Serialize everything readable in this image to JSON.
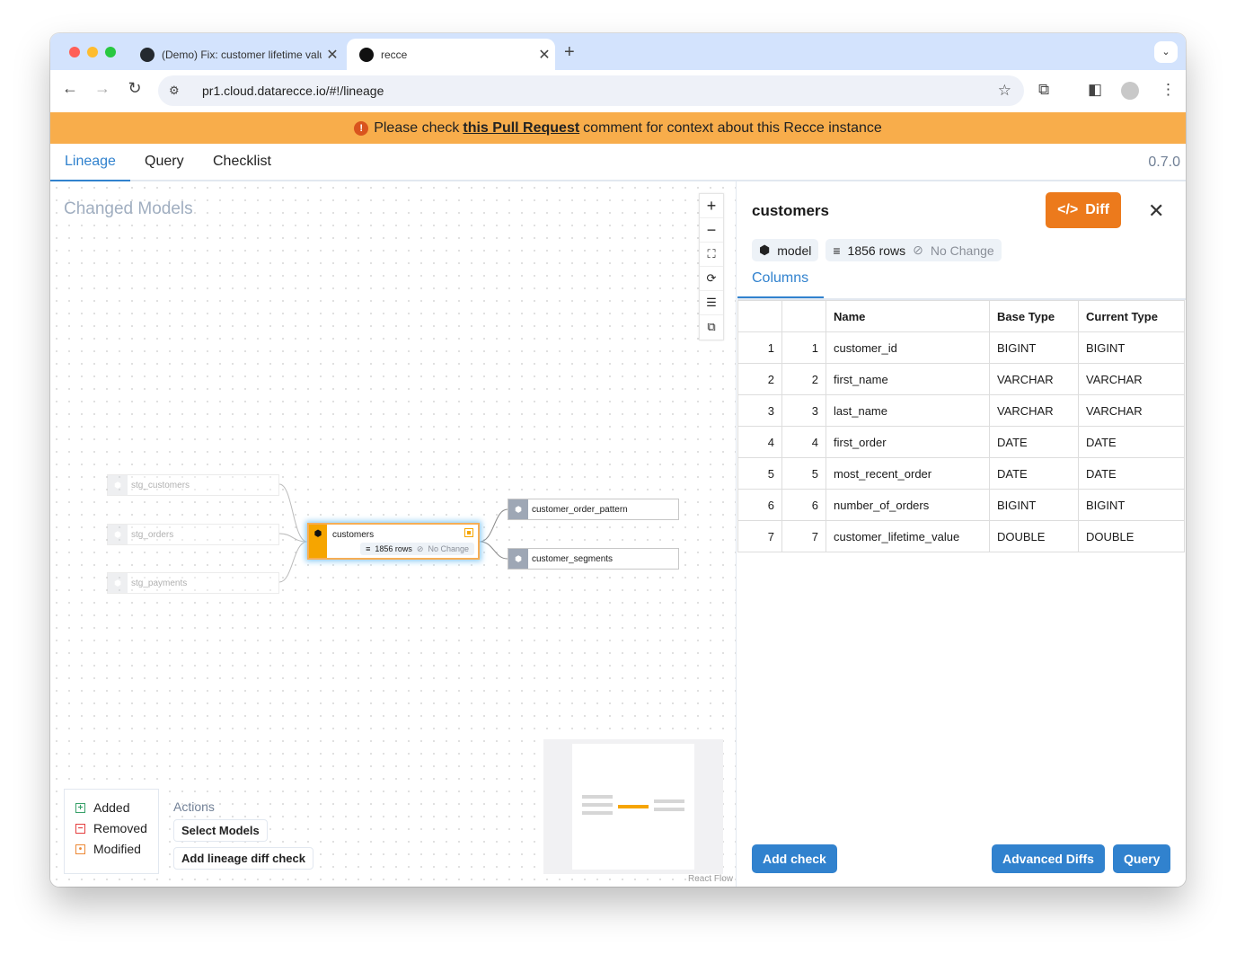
{
  "browser": {
    "tabs": [
      {
        "title": "(Demo) Fix: customer lifetime value"
      },
      {
        "title": "recce"
      }
    ],
    "url": "pr1.cloud.datarecce.io/#!/lineage"
  },
  "banner": {
    "pre": "Please check",
    "link": "this Pull Request",
    "post": "comment for context about this Recce instance"
  },
  "nav": {
    "tabs": [
      "Lineage",
      "Query",
      "Checklist"
    ],
    "active": "Lineage",
    "version": "0.7.0"
  },
  "canvas": {
    "title": "Changed Models",
    "upstream": [
      "stg_customers",
      "stg_orders",
      "stg_payments"
    ],
    "main": {
      "name": "customers",
      "rows": "1856 rows",
      "status": "No Change"
    },
    "downstream": [
      "customer_order_pattern",
      "customer_segments"
    ],
    "legend": [
      {
        "label": "Added",
        "color": "#38a169",
        "symbol": "+"
      },
      {
        "label": "Removed",
        "color": "#e53e3e",
        "symbol": "−"
      },
      {
        "label": "Modified",
        "color": "#ed8936",
        "symbol": "•"
      }
    ],
    "actions": {
      "label": "Actions",
      "buttons": [
        "Select Models",
        "Add lineage diff check"
      ]
    },
    "attribution": "React Flow"
  },
  "panel": {
    "title": "customers",
    "diff_label": "Diff",
    "type_tag": "model",
    "rows": "1856 rows",
    "status": "No Change",
    "tab": "Columns",
    "headers": [
      "",
      "",
      "Name",
      "Base Type",
      "Current Type"
    ],
    "rows_data": [
      [
        "1",
        "1",
        "customer_id",
        "BIGINT",
        "BIGINT"
      ],
      [
        "2",
        "2",
        "first_name",
        "VARCHAR",
        "VARCHAR"
      ],
      [
        "3",
        "3",
        "last_name",
        "VARCHAR",
        "VARCHAR"
      ],
      [
        "4",
        "4",
        "first_order",
        "DATE",
        "DATE"
      ],
      [
        "5",
        "5",
        "most_recent_order",
        "DATE",
        "DATE"
      ],
      [
        "6",
        "6",
        "number_of_orders",
        "BIGINT",
        "BIGINT"
      ],
      [
        "7",
        "7",
        "customer_lifetime_value",
        "DOUBLE",
        "DOUBLE"
      ]
    ],
    "buttons": {
      "add_check": "Add check",
      "advanced": "Advanced Diffs",
      "query": "Query"
    }
  },
  "colors": {
    "accent": "#3182ce",
    "banner": "#f8ad4b",
    "diff": "#ec7a1c",
    "modified": "#f6a500"
  }
}
